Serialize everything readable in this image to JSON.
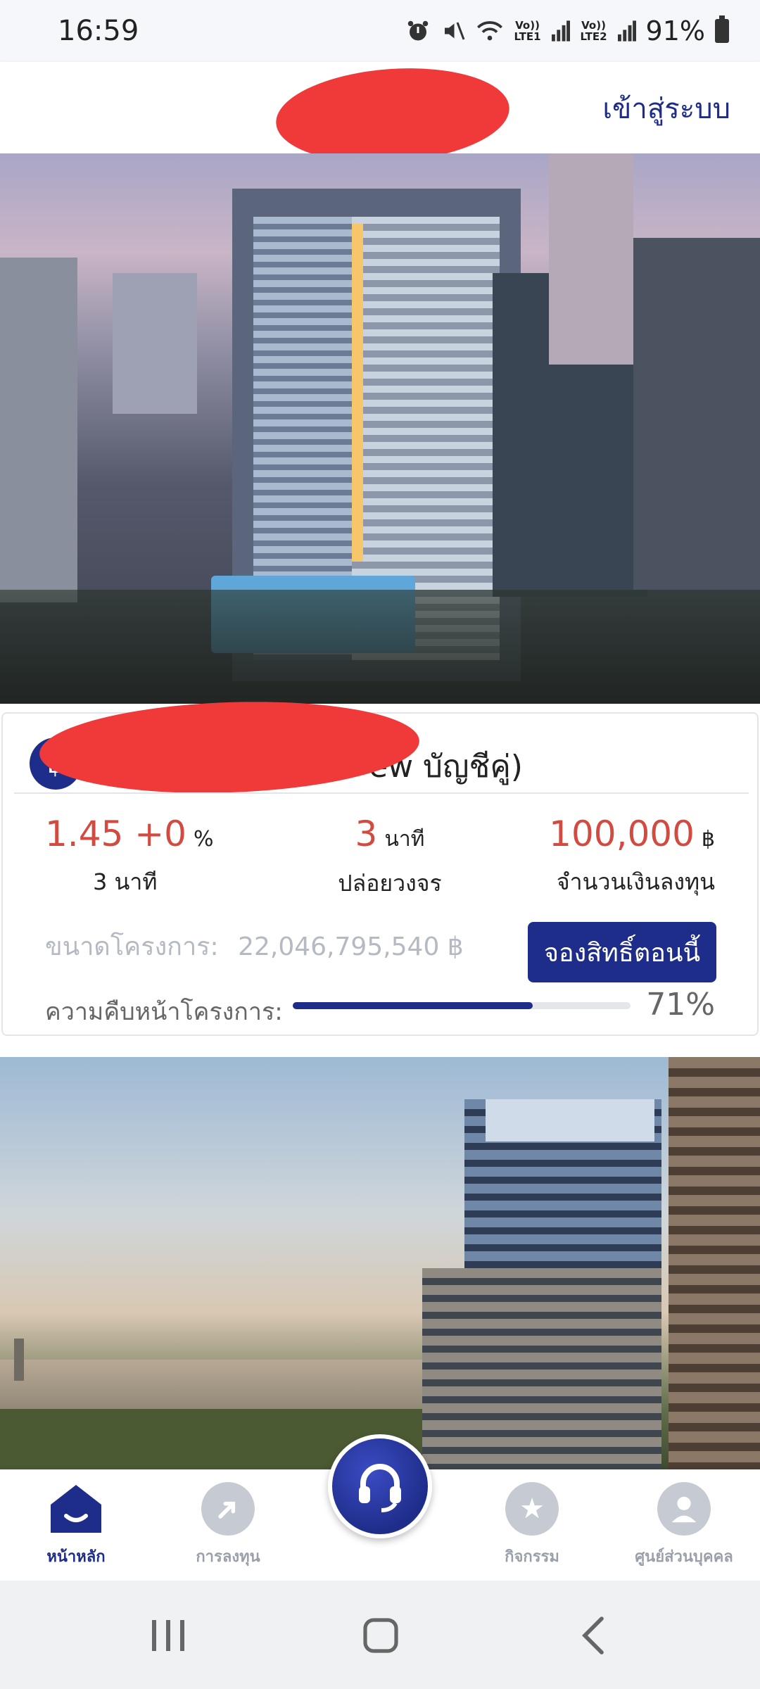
{
  "status_bar": {
    "time": "16:59",
    "lte1_label": "Vo)) LTE1",
    "lte2_label": "Vo)) LTE2",
    "battery": "91%"
  },
  "header": {
    "login_label": "เข้าสู่ระบบ"
  },
  "project": {
    "currency_symbol": "฿",
    "title_visible": "ew บัญชีคู่)",
    "rate_value": "1.45 +0",
    "rate_unit": "%",
    "rate_label": "3 นาที",
    "time_value": "3",
    "time_unit": "นาที",
    "time_label": "ปล่อยวงจร",
    "amount_value": "100,000",
    "amount_unit": "฿",
    "amount_label": "จำนวนเงินลงทุน",
    "size_label": "ขนาดโครงการ:",
    "size_value": "22,046,795,540 ฿",
    "reserve_button": "จองสิทธิ์ตอนนี้",
    "progress_label": "ความคืบหน้าโครงการ:",
    "progress_percent": 71,
    "progress_text": "71%"
  },
  "bottom_nav": {
    "home": "หน้าหลัก",
    "invest": "การลงทุน",
    "activities": "กิจกรรม",
    "profile": "ศูนย์ส่วนบุคคล"
  },
  "colors": {
    "brand": "#1f2d8a",
    "accent_red": "#d24b40",
    "redaction": "#f03a3a"
  }
}
